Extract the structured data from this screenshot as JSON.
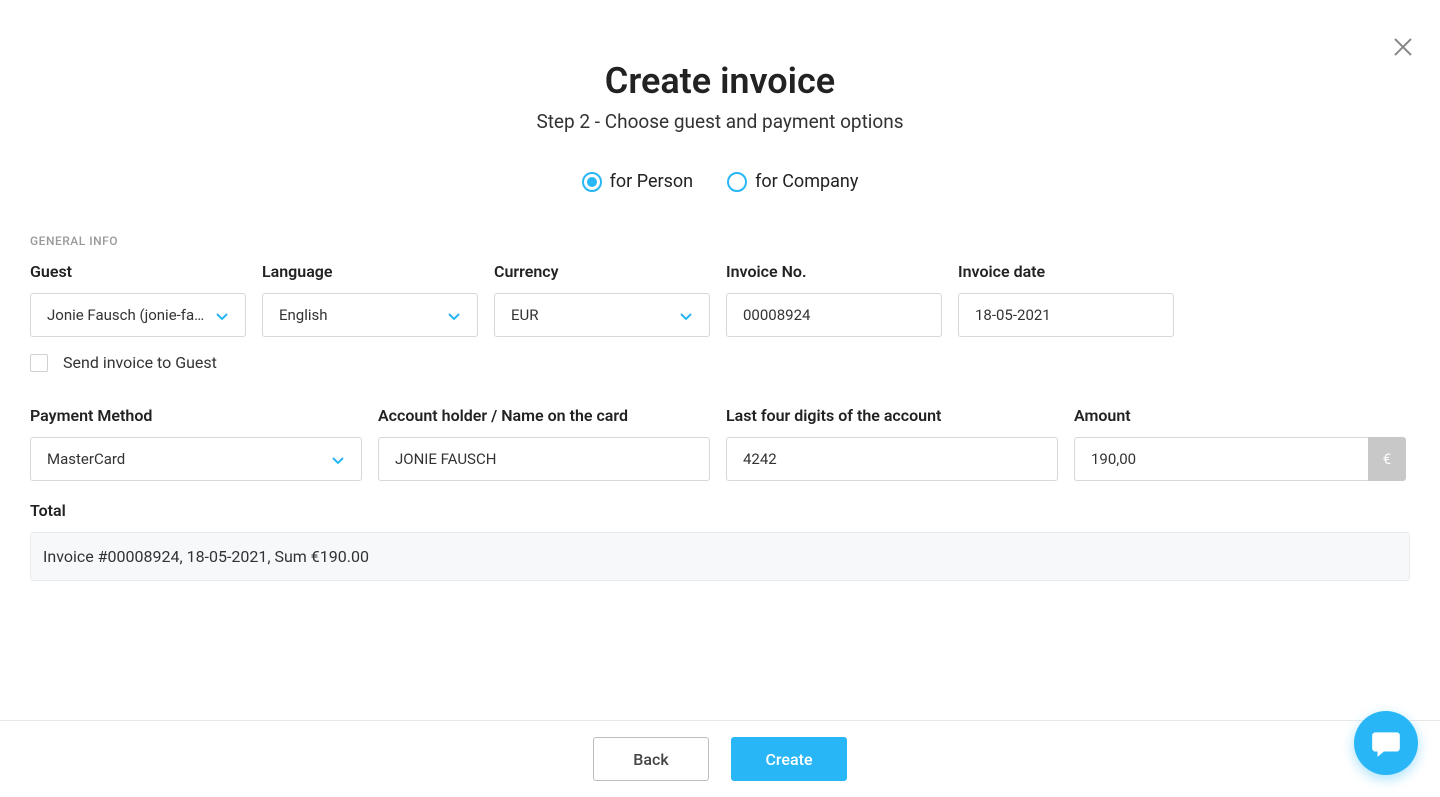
{
  "header": {
    "title": "Create invoice",
    "subtitle": "Step 2 - Choose guest and payment options"
  },
  "invoice_type": {
    "person_label": "for Person",
    "company_label": "for Company",
    "selected": "person"
  },
  "sections": {
    "general_info_label": "GENERAL INFO"
  },
  "fields": {
    "guest": {
      "label": "Guest",
      "value": "Jonie Fausch (jonie-fau…"
    },
    "language": {
      "label": "Language",
      "value": "English"
    },
    "currency": {
      "label": "Currency",
      "value": "EUR"
    },
    "invoice_no": {
      "label": "Invoice No.",
      "value": "00008924"
    },
    "invoice_date": {
      "label": "Invoice date",
      "value": "18-05-2021"
    },
    "send_invoice": {
      "label": "Send invoice to Guest"
    },
    "payment_method": {
      "label": "Payment Method",
      "value": "MasterCard"
    },
    "account_holder": {
      "label": "Account holder / Name on the card",
      "value": "JONIE FAUSCH"
    },
    "last_four": {
      "label": "Last four digits of the account",
      "value": "4242"
    },
    "amount": {
      "label": "Amount",
      "value": "190,00",
      "currency_symbol": "€"
    },
    "total": {
      "label": "Total",
      "summary": "Invoice #00008924, 18-05-2021, Sum €190.00"
    }
  },
  "footer": {
    "back_label": "Back",
    "create_label": "Create"
  }
}
